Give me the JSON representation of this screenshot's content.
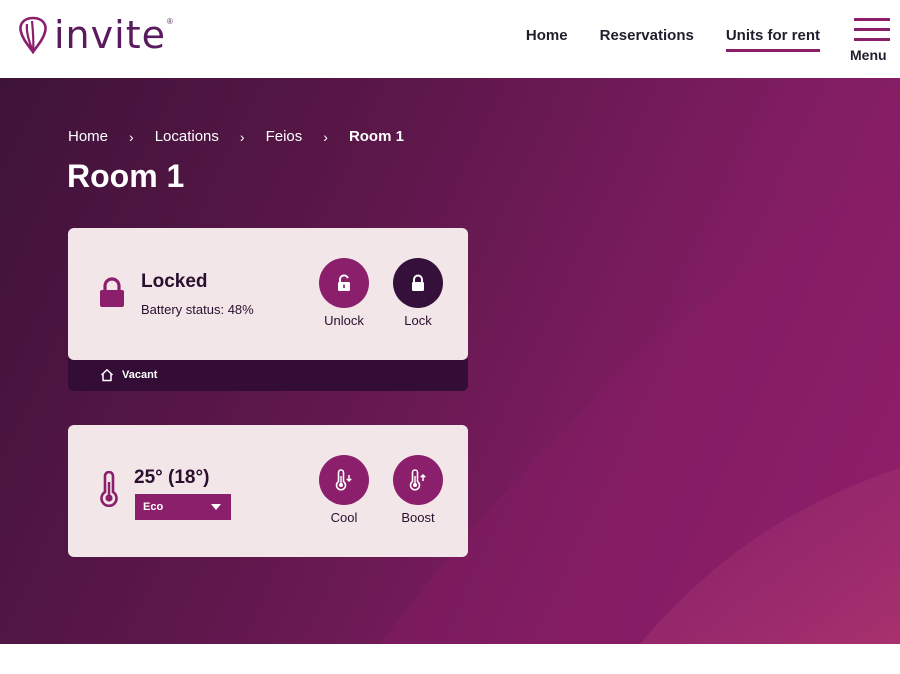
{
  "brand": {
    "name": "invite",
    "reg_mark": "®"
  },
  "nav": {
    "links": [
      {
        "label": "Home"
      },
      {
        "label": "Reservations"
      },
      {
        "label": "Units for rent",
        "active": true
      }
    ],
    "menu_label": "Menu"
  },
  "breadcrumb": [
    "Home",
    "Locations",
    "Feios",
    "Room 1"
  ],
  "breadcrumb_sep": "›",
  "page_title": "Room 1",
  "lock_card": {
    "status": "Locked",
    "battery": "Battery status: 48%",
    "actions": [
      {
        "label": "Unlock",
        "icon": "lock-open-icon"
      },
      {
        "label": "Lock",
        "icon": "lock-closed-icon"
      }
    ],
    "footer": "Vacant",
    "footer_icon": "home-icon"
  },
  "climate_card": {
    "temperature": "25° (18°)",
    "mode": "Eco",
    "actions": [
      {
        "label": "Cool",
        "icon": "thermometer-down-icon"
      },
      {
        "label": "Boost",
        "icon": "thermometer-up-icon"
      }
    ]
  },
  "colors": {
    "accent": "#8b1f6b",
    "dark": "#35103a",
    "card_bg": "#f3e6e9",
    "hero_start": "#3e1339",
    "hero_end": "#951f6c"
  }
}
